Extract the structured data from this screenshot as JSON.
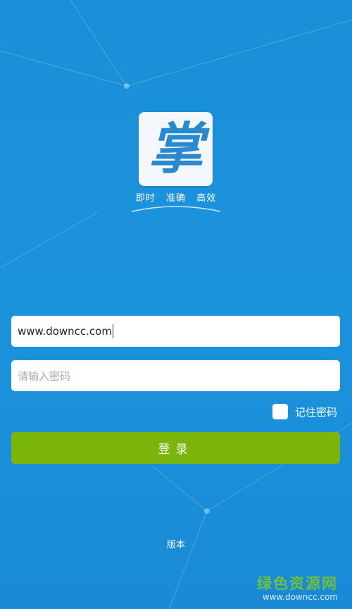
{
  "logo": {
    "glyph": "掌"
  },
  "tagline": [
    "即时",
    "准确",
    "高效"
  ],
  "username": {
    "value": "www.downcc.com"
  },
  "password": {
    "placeholder": "请输入密码"
  },
  "remember": {
    "label": "记住密码",
    "checked": false
  },
  "login": {
    "label": "登录"
  },
  "footer": {
    "version": "版本"
  },
  "watermark": {
    "title": "绿色资源网",
    "url": "www.downcc.com"
  },
  "colors": {
    "background": "#1a8fd8",
    "button": "#7cb50a",
    "logo_blue": "#2a88cf",
    "watermark_green": "#6dbf3e"
  }
}
